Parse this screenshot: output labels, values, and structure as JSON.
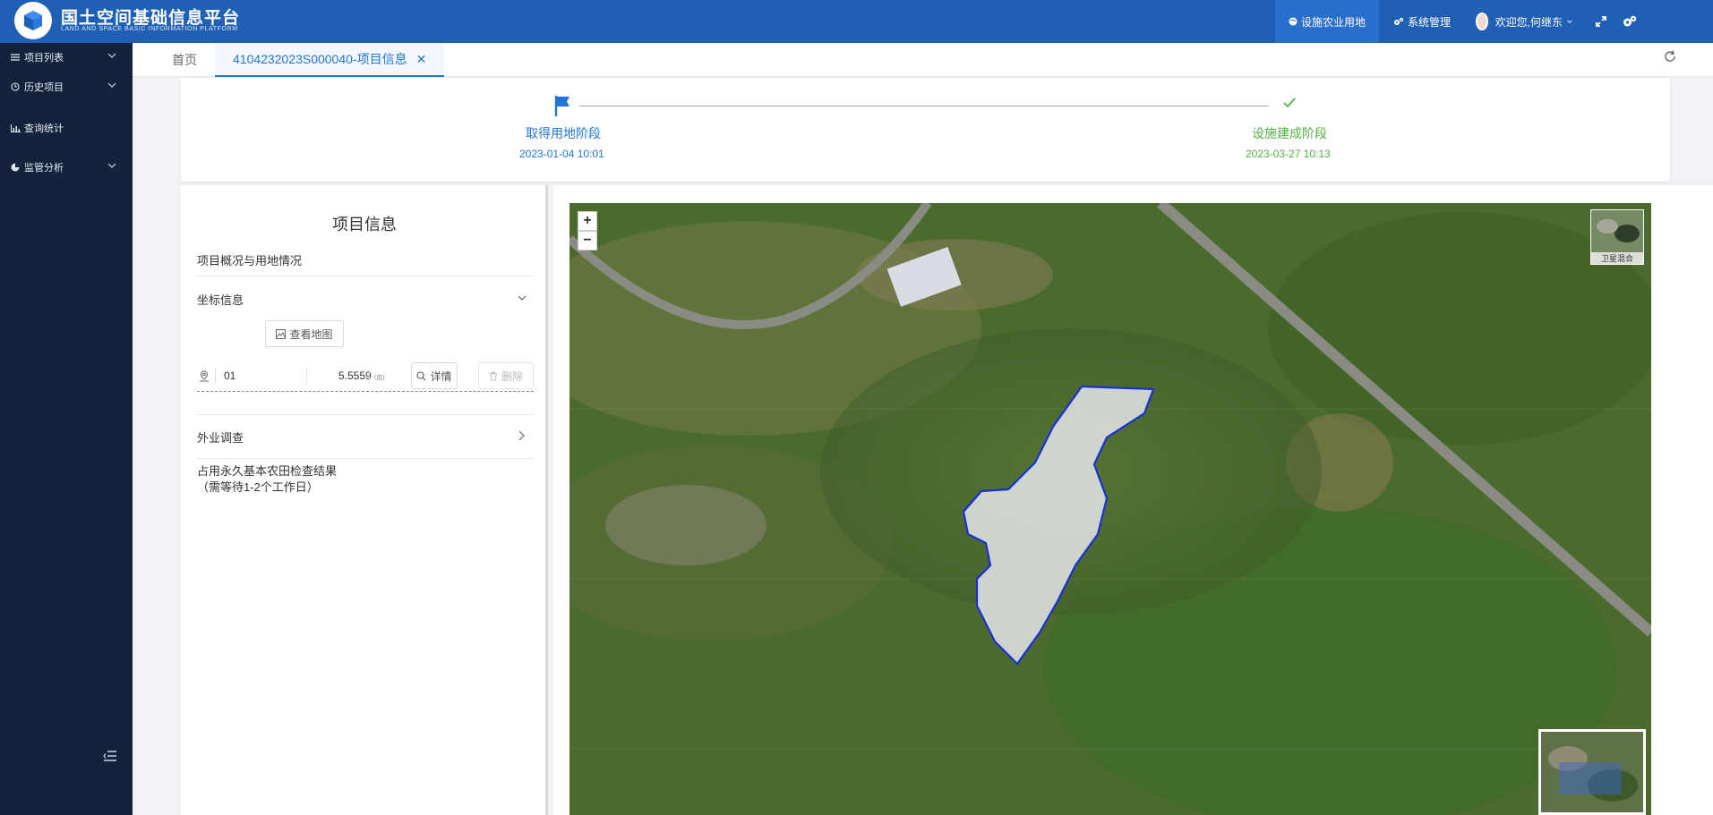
{
  "header": {
    "title": "国土空间基础信息平台",
    "subtitle": "LAND AND SPACE BASIC INFORMATION PLATFORM",
    "nav": [
      {
        "label": "设施农业用地",
        "active": true
      },
      {
        "label": "系统管理",
        "active": false
      }
    ],
    "user_greeting": "欢迎您,何继东",
    "accent": "#1f5fb4"
  },
  "sidebar": {
    "items": [
      {
        "label": "项目列表",
        "icon": "list-icon",
        "expandable": true
      },
      {
        "label": "历史项目",
        "icon": "history-icon",
        "expandable": true
      },
      {
        "label": "查询统计",
        "icon": "bar-chart-icon",
        "expandable": false
      },
      {
        "label": "监管分析",
        "icon": "pie-chart-icon",
        "expandable": true
      }
    ]
  },
  "tabs": {
    "home": "首页",
    "active": "4104232023S000040-项目信息"
  },
  "steps": [
    {
      "title": "取得用地阶段",
      "date": "2023-01-04 10:01",
      "status": "current"
    },
    {
      "title": "设施建成阶段",
      "date": "2023-03-27 10:13",
      "status": "done"
    }
  ],
  "info": {
    "title": "项目信息",
    "overview": "项目概况与用地情况",
    "coords_section": "坐标信息",
    "view_map": "查看地图",
    "coord_row": {
      "number": "01",
      "area": "5.5559",
      "unit": "(亩)",
      "detail": "详情",
      "delete": "删除"
    },
    "field_survey": "外业调查",
    "result_line1": "占用永久基本农田检查结果",
    "result_line2": "（需等待1-2个工作日）"
  },
  "map": {
    "zoom_in": "+",
    "zoom_out": "−",
    "layer_label": "卫星混合"
  }
}
